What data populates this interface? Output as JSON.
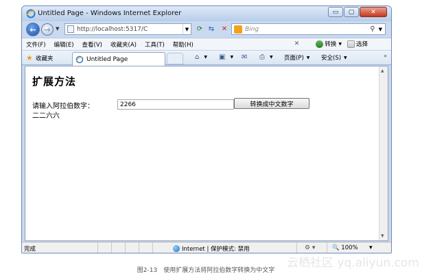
{
  "window": {
    "title": "Untitled Page - Windows Internet Explorer",
    "minimize_label": "▭",
    "maximize_label": "▢",
    "close_label": "✕"
  },
  "address": {
    "url": "http://localhost:5317/C",
    "search_placeholder": "Bing"
  },
  "menu": {
    "items": [
      "文件(F)",
      "编辑(E)",
      "查看(V)",
      "收藏夹(A)",
      "工具(T)",
      "帮助(H)"
    ],
    "translate_label": "转换",
    "select_label": "选择"
  },
  "favorites": {
    "label": "收藏夹",
    "tab_label": "Untitled Page",
    "page_menu": "页面(P)",
    "safety_menu": "安全(S)"
  },
  "page": {
    "heading": "扩展方法",
    "prompt": "请输入阿拉伯数字：",
    "input_value": "2266",
    "button_label": "转换成中文数字",
    "result": "二二六六"
  },
  "status": {
    "text": "完成",
    "zone": "Internet | 保护模式: 禁用",
    "zoom": "100%"
  },
  "caption": "图2-13　使用扩展方法将阿拉伯数字转换为中文字",
  "watermark": "云栖社区 yq.aliyun.com"
}
